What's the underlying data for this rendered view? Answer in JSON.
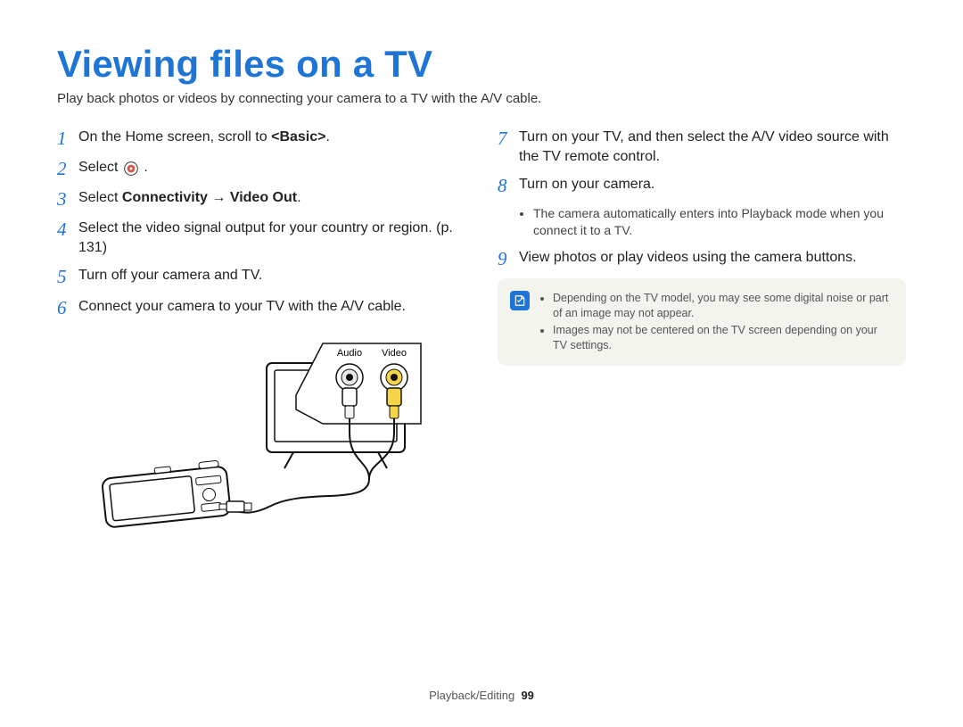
{
  "title": "Viewing files on a TV",
  "subtitle": "Play back photos or videos by connecting your camera to a TV with the A/V cable.",
  "diagram_labels": {
    "audio": "Audio",
    "video": "Video"
  },
  "left_steps": [
    {
      "num": "1",
      "parts": [
        {
          "t": "On the Home screen, scroll to "
        },
        {
          "t": "<Basic>",
          "bold": true
        },
        {
          "t": "."
        }
      ]
    },
    {
      "num": "2",
      "parts": [
        {
          "t": "Select "
        },
        {
          "icon": "select-icon"
        },
        {
          "t": " ."
        }
      ]
    },
    {
      "num": "3",
      "parts": [
        {
          "t": "Select "
        },
        {
          "t": "Connectivity",
          "bold": true
        },
        {
          "t": " → "
        },
        {
          "t": "Video Out",
          "bold": true
        },
        {
          "t": "."
        }
      ]
    },
    {
      "num": "4",
      "parts": [
        {
          "t": "Select the video signal output for your country or region. (p. 131)"
        }
      ]
    },
    {
      "num": "5",
      "parts": [
        {
          "t": "Turn off your camera and TV."
        }
      ]
    },
    {
      "num": "6",
      "parts": [
        {
          "t": "Connect your camera to your TV with the A/V cable."
        }
      ]
    }
  ],
  "right_steps": [
    {
      "num": "7",
      "parts": [
        {
          "t": "Turn on your TV, and then select the A/V video source with the TV remote control."
        }
      ]
    },
    {
      "num": "8",
      "parts": [
        {
          "t": "Turn on your camera."
        }
      ],
      "bullets": [
        "The camera automatically enters into Playback mode when you connect it to a TV."
      ]
    },
    {
      "num": "9",
      "parts": [
        {
          "t": "View photos or play videos using the camera buttons."
        }
      ]
    }
  ],
  "notes": [
    "Depending on the TV model, you may see some digital noise or part of an image may not appear.",
    "Images may not be centered on the TV screen depending on your TV settings."
  ],
  "footer": {
    "section": "Playback/Editing",
    "page": "99"
  }
}
